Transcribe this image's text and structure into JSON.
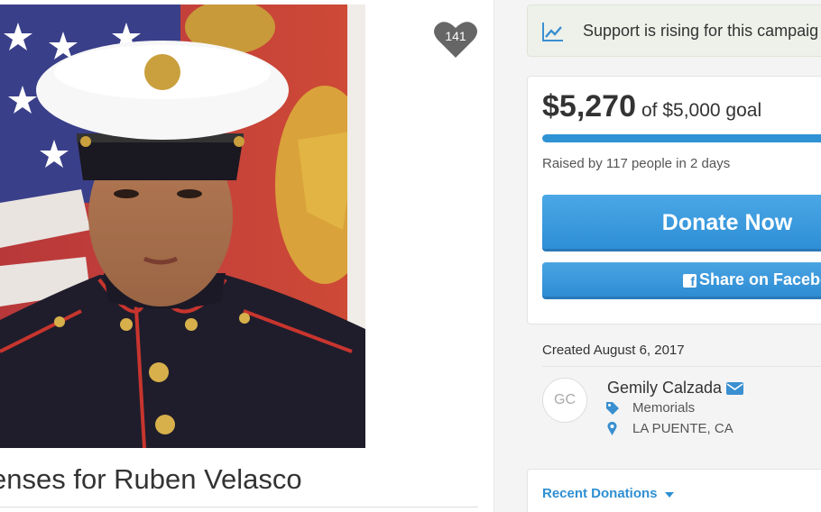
{
  "campaign": {
    "title": "enses for Ruben Velasco",
    "photo_icon": "marine-portrait-image",
    "heart_count": "141"
  },
  "banner": {
    "icon": "trend-up-icon",
    "text": "Support is rising for this campaig"
  },
  "funding": {
    "raised": "$5,270",
    "goal_text": "of $5,000 goal",
    "progress_fraction": 1.0,
    "raised_by": "Raised by 117 people in 2 days",
    "donate_label": "Donate Now",
    "share_label": "Share on Facebo",
    "facebook_glyph": "f"
  },
  "organizer": {
    "created": "Created August 6, 2017",
    "initials": "GC",
    "name": "Gemily Calzada",
    "category": "Memorials",
    "location": "LA PUENTE, CA"
  },
  "recent": {
    "label": "Recent Donations"
  },
  "colors": {
    "accent": "#2e92d4",
    "banner_bg": "#eef1ea",
    "heart": "#666666"
  }
}
